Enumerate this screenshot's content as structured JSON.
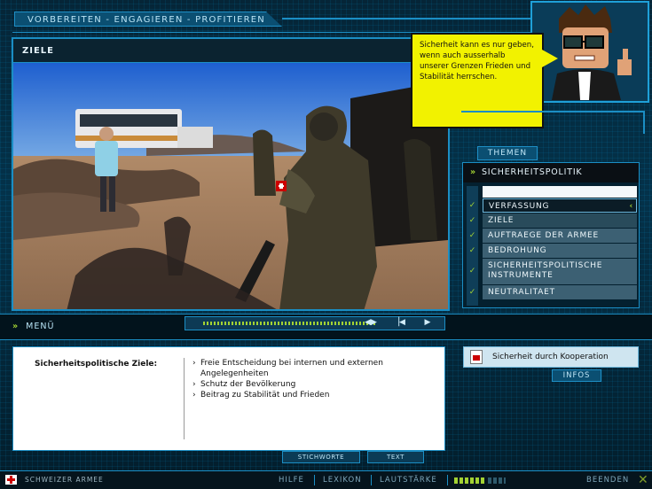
{
  "header": {
    "title": "VORBEREITEN - ENGAGIEREN - PROFITIEREN"
  },
  "image_panel": {
    "heading": "ZIELE"
  },
  "bubble": {
    "text": "Sicherheit kann es nur geben, wenn auch ausserhalb unserer Grenzen Frieden und Stabilität herrschen."
  },
  "themes": {
    "tab_label": "THEMEN",
    "section_title": "SICHERHEITSPOLITIK",
    "items": [
      {
        "label": "VERFASSUNG"
      },
      {
        "label": "ZIELE"
      },
      {
        "label": "AUFTRAEGE DER ARMEE"
      },
      {
        "label": "BEDROHUNG"
      },
      {
        "label": "SICHERHEITSPOLITISCHE INSTRUMENTE"
      },
      {
        "label": "NEUTRALITAET"
      }
    ],
    "check": "✓"
  },
  "menu": {
    "label": "MENÜ"
  },
  "content": {
    "title": "Sicherheitspolitische Ziele:",
    "points": [
      "Freie Entscheidung bei internen und externen Angelegenheiten",
      "Schutz der Bevölkerung",
      "Beitrag zu Stabilität und Frieden"
    ],
    "tabs": {
      "keywords": "STICHWORTE",
      "text": "TEXT"
    }
  },
  "infos": {
    "item_label": "Sicherheit durch Kooperation",
    "tab_label": "INFOS"
  },
  "footer": {
    "brand": "SCHWEIZER ARMEE",
    "help": "HILFE",
    "lexicon": "LEXIKON",
    "volume": "LAUTSTÄRKE",
    "quit": "BEENDEN"
  },
  "colors": {
    "accent_green": "#a3d233",
    "frame_blue": "#1b8ec4",
    "bubble_yellow": "#f2f200"
  }
}
